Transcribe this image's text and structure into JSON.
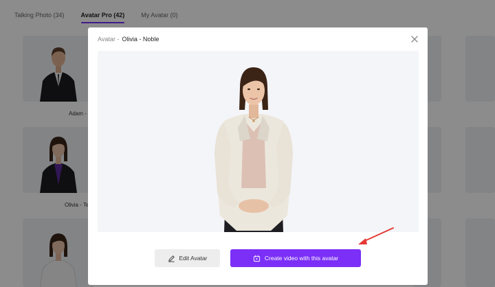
{
  "tabs": [
    {
      "label": "Talking Photo (34)",
      "active": false
    },
    {
      "label": "Avatar Pro (42)",
      "active": true
    },
    {
      "label": "My Avatar (0)",
      "active": false
    }
  ],
  "cards": [
    {
      "label": "Adam -",
      "suit": "#1c1c1f"
    },
    {
      "label": "Olivia - Te",
      "suit": "#1c1c1f"
    },
    {
      "label": "",
      "suit": "#f2f2f2"
    }
  ],
  "modal": {
    "title_prefix": "Avatar -",
    "title_name": "Olivia - Noble",
    "edit_label": "Edit Avatar",
    "create_label": "Create video with this avatar"
  },
  "colors": {
    "accent": "#7b2ff7",
    "annotation_arrow": "#e53935"
  },
  "icons": {
    "close": "close-icon",
    "edit": "pencil-icon",
    "create": "video-calendar-icon"
  }
}
